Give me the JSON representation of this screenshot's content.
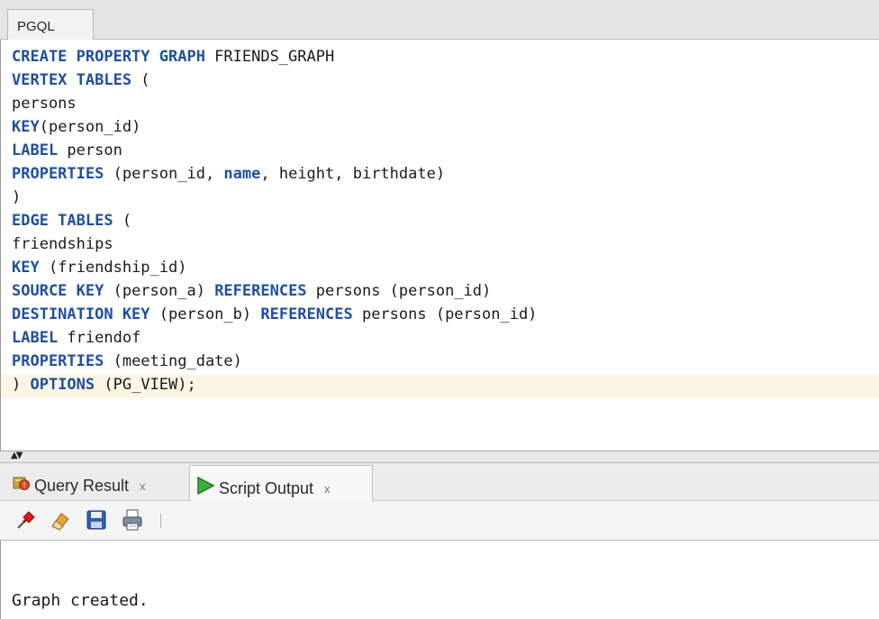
{
  "editor_tab": {
    "label": "PGQL"
  },
  "code": {
    "lines": [
      [
        {
          "t": "CREATE PROPERTY GRAPH",
          "k": true
        },
        {
          "t": " FRIENDS_GRAPH",
          "k": false
        }
      ],
      [
        {
          "t": "VERTEX TABLES",
          "k": true
        },
        {
          "t": " (",
          "k": false
        }
      ],
      [
        {
          "t": "persons",
          "k": false
        }
      ],
      [
        {
          "t": "KEY",
          "k": true
        },
        {
          "t": "(person_id)",
          "k": false
        }
      ],
      [
        {
          "t": "LABEL",
          "k": true
        },
        {
          "t": " person",
          "k": false
        }
      ],
      [
        {
          "t": "PROPERTIES",
          "k": true
        },
        {
          "t": " (person_id, ",
          "k": false
        },
        {
          "t": "name",
          "k": true
        },
        {
          "t": ", height, birthdate)",
          "k": false
        }
      ],
      [
        {
          "t": ")",
          "k": false
        }
      ],
      [
        {
          "t": "EDGE TABLES",
          "k": true
        },
        {
          "t": " (",
          "k": false
        }
      ],
      [
        {
          "t": "friendships",
          "k": false
        }
      ],
      [
        {
          "t": "KEY",
          "k": true
        },
        {
          "t": " (friendship_id)",
          "k": false
        }
      ],
      [
        {
          "t": "SOURCE KEY",
          "k": true
        },
        {
          "t": " (person_a) ",
          "k": false
        },
        {
          "t": "REFERENCES",
          "k": true
        },
        {
          "t": " persons (person_id)",
          "k": false
        }
      ],
      [
        {
          "t": "DESTINATION KEY",
          "k": true
        },
        {
          "t": " (person_b) ",
          "k": false
        },
        {
          "t": "REFERENCES",
          "k": true
        },
        {
          "t": " persons (person_id)",
          "k": false
        }
      ],
      [
        {
          "t": "LABEL",
          "k": true
        },
        {
          "t": " friendof",
          "k": false
        }
      ],
      [
        {
          "t": "PROPERTIES",
          "k": true
        },
        {
          "t": " (meeting_date)",
          "k": false
        }
      ],
      [
        {
          "t": ") ",
          "k": false
        },
        {
          "t": "OPTIONS",
          "k": true
        },
        {
          "t": " (PG_VIEW);",
          "k": false
        }
      ]
    ],
    "keyword_color": "#1f4f9e",
    "current_line_color": "#fcf5e3"
  },
  "output_tabs": {
    "query_result": {
      "label": "Query Result",
      "close": "x"
    },
    "script_output": {
      "label": "Script Output",
      "close": "x"
    }
  },
  "toolbar": {
    "icons": [
      "pin-icon",
      "eraser-icon",
      "save-icon",
      "print-icon"
    ]
  },
  "output": {
    "text": "Graph created."
  }
}
